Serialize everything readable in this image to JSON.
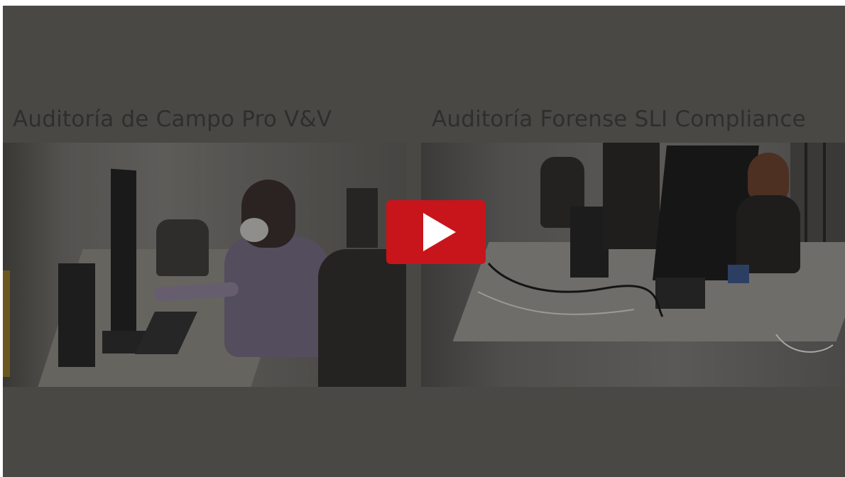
{
  "video": {
    "left_title": "Auditoría de Campo Pro V&V",
    "right_title": "Auditoría Forense SLI Compliance",
    "play_icon": "play-icon",
    "accent_color": "#c8151b"
  }
}
